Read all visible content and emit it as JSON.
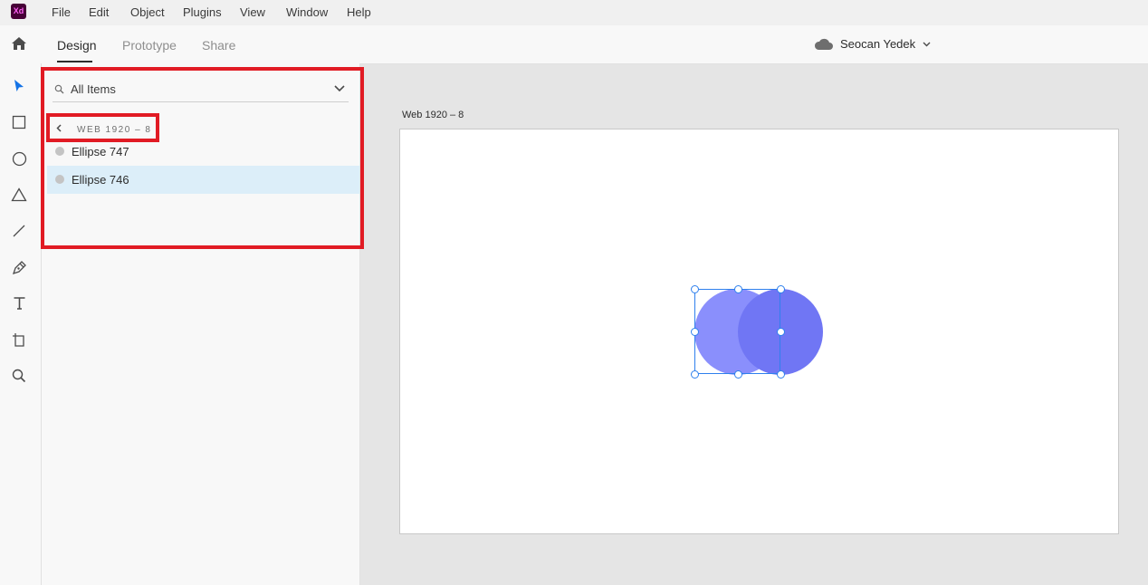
{
  "app": {
    "logo_text": "Xd"
  },
  "menu": [
    "File",
    "Edit",
    "Object",
    "Plugins",
    "View",
    "Window",
    "Help"
  ],
  "tabs": [
    {
      "label": "Design",
      "active": true
    },
    {
      "label": "Prototype",
      "active": false
    },
    {
      "label": "Share",
      "active": false
    }
  ],
  "user": {
    "name": "Seocan Yedek"
  },
  "tools": [
    "select-tool",
    "rectangle-tool",
    "ellipse-tool",
    "polygon-tool",
    "line-tool",
    "pen-tool",
    "text-tool",
    "artboard-tool",
    "zoom-tool"
  ],
  "layers": {
    "search_text": "All Items",
    "breadcrumb": "WEB 1920 – 8",
    "items": [
      {
        "name": "Ellipse 747",
        "selected": false
      },
      {
        "name": "Ellipse 746",
        "selected": true
      }
    ]
  },
  "canvas": {
    "artboard_label": "Web 1920 – 8"
  },
  "colors": {
    "accent": "#2680eb",
    "ellipse_left": "#8a8ffc",
    "ellipse_right": "#7076f4",
    "highlight": "#e11b24"
  }
}
